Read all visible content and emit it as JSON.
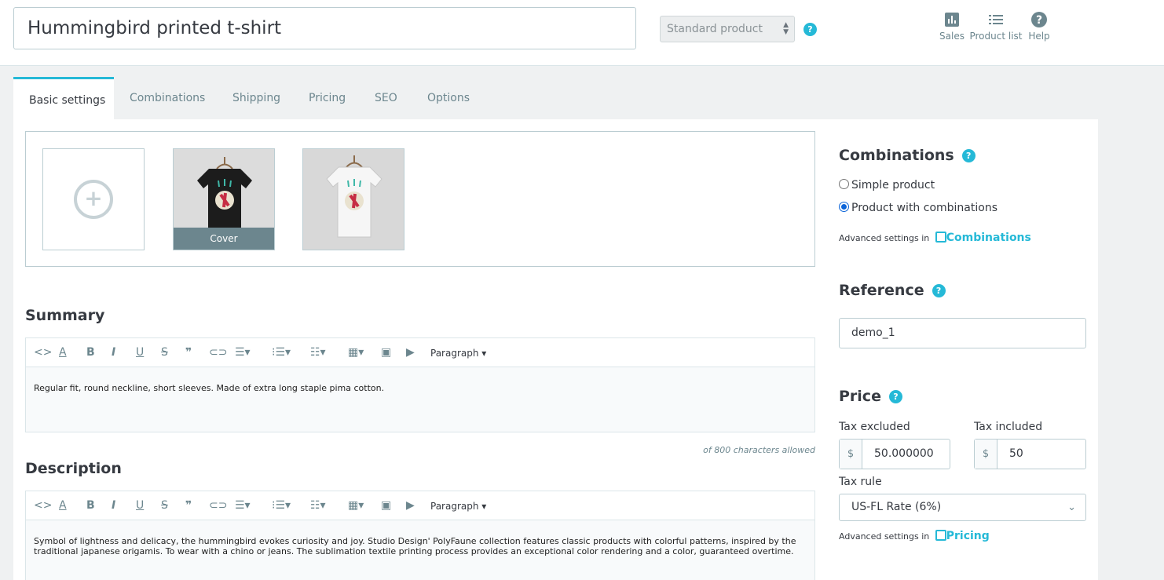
{
  "header": {
    "product_name": "Hummingbird printed t-shirt",
    "product_type": "Standard product",
    "help": "?",
    "toolbar": [
      {
        "label": "Sales",
        "icon": "bar-chart-icon"
      },
      {
        "label": "Product list",
        "icon": "list-icon"
      },
      {
        "label": "Help",
        "icon": "help-icon"
      }
    ]
  },
  "tabs": [
    "Basic settings",
    "Combinations",
    "Shipping",
    "Pricing",
    "SEO",
    "Options"
  ],
  "images": {
    "cover_label": "Cover"
  },
  "summary": {
    "title": "Summary",
    "paragraph_label": "Paragraph",
    "text": "Regular fit, round neckline, short sleeves. Made of extra long staple pima cotton.",
    "char_count": "of 800 characters allowed"
  },
  "description": {
    "title": "Description",
    "paragraph_label": "Paragraph",
    "text": "Symbol of lightness and delicacy, the hummingbird evokes curiosity and joy. Studio Design' PolyFaune collection features classic products with colorful patterns, inspired by the traditional japanese origamis. To wear with a chino or jeans. The sublimation textile printing process provides an exceptional color rendering and a color, guaranteed overtime."
  },
  "combinations": {
    "title": "Combinations",
    "options": [
      "Simple product",
      "Product with combinations"
    ],
    "selected": "Product with combinations",
    "advanced_prefix": "Advanced settings in",
    "advanced_link": "Combinations"
  },
  "reference": {
    "title": "Reference",
    "value": "demo_1"
  },
  "price": {
    "title": "Price",
    "tax_excluded_label": "Tax excluded",
    "tax_included_label": "Tax included",
    "currency": "$",
    "tax_excluded": "50.000000",
    "tax_included": "50",
    "tax_rule_label": "Tax rule",
    "tax_rule": "US-FL Rate (6%)",
    "advanced_prefix": "Advanced settings in",
    "advanced_link": "Pricing"
  },
  "colors": {
    "accent": "#25b9d7",
    "text": "#363a41",
    "muted": "#6c868e"
  }
}
